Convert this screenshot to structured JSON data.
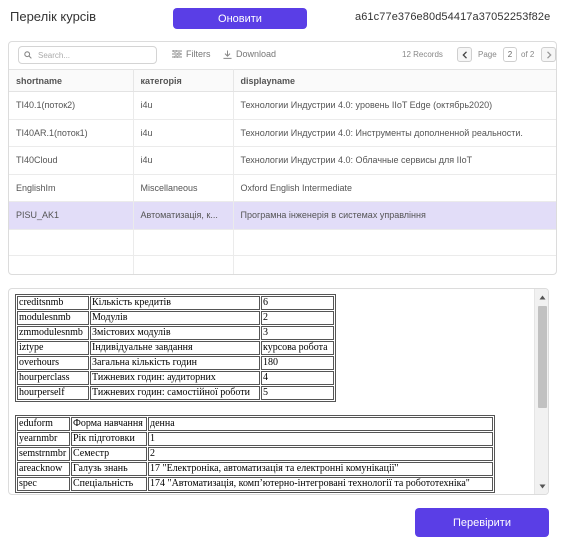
{
  "header": {
    "title": "Перелік курсів",
    "refresh_label": "Оновити",
    "hash": "a61c77e376e80d54417a37052253f82e"
  },
  "grid": {
    "search_placeholder": "Search...",
    "filters_label": "Filters",
    "download_label": "Download",
    "records_text": "12 Records",
    "page_label": "Page",
    "page_current": "2",
    "page_of": "of 2",
    "columns": [
      "shortname",
      "категорія",
      "displayname"
    ],
    "rows": [
      [
        "TI40.1(поток2)",
        "i4u",
        "Технологии Индустрии 4.0: уровень IIoT Edge (октябрь2020)"
      ],
      [
        "TI40AR.1(поток1)",
        "i4u",
        "Технологии Индустрии 4.0: Инструменты дополненной реальности."
      ],
      [
        "TI40Cloud",
        "i4u",
        "Технологии Индустрии 4.0: Облачные сервисы для IIoT"
      ],
      [
        "EnglishIm",
        "Miscellaneous",
        "Oxford English Intermediate"
      ],
      [
        "PISU_AK1",
        "Автоматизація, к...",
        "Програмна інженерія в системах управління"
      ]
    ],
    "selected_row": 4
  },
  "details": {
    "table1": [
      [
        "creditsnmb",
        "Кількість кредитів",
        "6"
      ],
      [
        "modulesnmb",
        "Модулів",
        "2"
      ],
      [
        "zmmodulesnmb",
        "Змістових модулів",
        "3"
      ],
      [
        "iztype",
        "Індивідуальне завдання",
        "курсова робота"
      ],
      [
        "overhours",
        "Загальна кількість годин",
        "180"
      ],
      [
        "hourperclass",
        "Тижневих годин: аудиторних",
        "4"
      ],
      [
        "hourperself",
        "Тижневих годин: самостійної роботи",
        "5"
      ]
    ],
    "table2": [
      [
        "eduform",
        "Форма навчання",
        "денна"
      ],
      [
        "yearnmbr",
        "Рік підготовки",
        "1"
      ],
      [
        "semstrnmbr",
        "Семестр",
        "2"
      ],
      [
        "areacknow",
        "Галузь знань",
        "17 \"Електроніка, автоматизація та електронні комунікації\""
      ],
      [
        "spec",
        "Спеціальність",
        "174 \"Автоматизація, комп’ютерно-інтегровані технології та робототехніка\""
      ]
    ]
  },
  "footer": {
    "check_label": "Перевірити"
  },
  "colors": {
    "accent": "#5a3ee6",
    "selected_row": "#e2ddf8"
  }
}
